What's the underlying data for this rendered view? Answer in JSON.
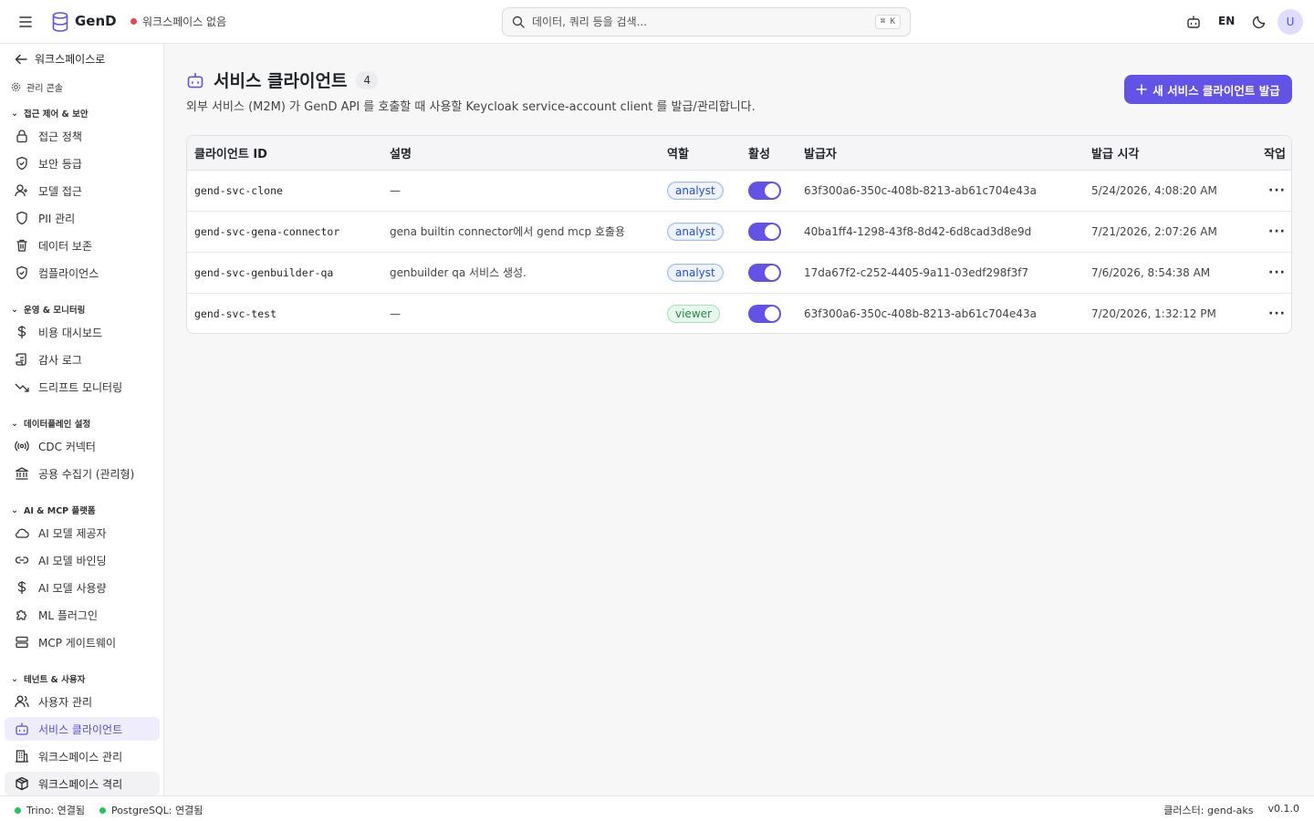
{
  "header": {
    "brand": "GenD",
    "workspace_status": "워크스페이스 없음",
    "workspace_status_color": "#e5484d",
    "search_placeholder": "데이터, 쿼리 등을 검색...",
    "search_shortcut": "⌘ K",
    "lang": "EN",
    "avatar": "U"
  },
  "sidebar": {
    "back_label": "워크스페이스로",
    "admin_label": "관리 콘솔",
    "sections": [
      {
        "label": "접근 제어 & 보안",
        "items": [
          "접근 정책",
          "보안 등급",
          "모델 접근",
          "PII 관리",
          "데이터 보존",
          "컴플라이언스"
        ]
      },
      {
        "label": "운영 & 모니터링",
        "items": [
          "비용 대시보드",
          "감사 로그",
          "드리프트 모니터링"
        ]
      },
      {
        "label": "데이터플레인 설정",
        "items": [
          "CDC 커넥터",
          "공용 수집기 (관리형)"
        ]
      },
      {
        "label": "AI & MCP 플랫폼",
        "items": [
          "AI 모델 제공자",
          "AI 모델 바인딩",
          "AI 모델 사용량",
          "ML 플러그인",
          "MCP 게이트웨이"
        ]
      },
      {
        "label": "테넌트 & 사용자",
        "items": [
          "사용자 관리",
          "서비스 클라이언트",
          "워크스페이스 관리",
          "워크스페이스 격리"
        ]
      }
    ]
  },
  "main": {
    "title": "서비스 클라이언트",
    "count": "4",
    "subtitle": "외부 서비스 (M2M) 가 GenD API 를 호출할 때 사용할 Keycloak service-account client 를 발급/관리합니다.",
    "primary_button": "새 서비스 클라이언트 발급",
    "accent_color": "#6352e6",
    "table": {
      "columns": [
        "클라이언트 ID",
        "설명",
        "역할",
        "활성",
        "발급자",
        "발급 시각",
        "작업"
      ],
      "rows": [
        {
          "id": "gend-svc-clone",
          "desc": "—",
          "role": "analyst",
          "active": true,
          "issuer": "63f300a6-350c-408b-8213-ab61c704e43a",
          "issued_at": "5/24/2026, 4:08:20 AM"
        },
        {
          "id": "gend-svc-gena-connector",
          "desc": "gena builtin connector에서 gend mcp 호출용",
          "role": "analyst",
          "active": true,
          "issuer": "40ba1ff4-1298-43f8-8d42-6d8cad3d8e9d",
          "issued_at": "7/21/2026, 2:07:26 AM"
        },
        {
          "id": "gend-svc-genbuilder-qa",
          "desc": "genbuilder qa 서비스 생성.",
          "role": "analyst",
          "active": true,
          "issuer": "17da67f2-c252-4405-9a11-03edf298f3f7",
          "issued_at": "7/6/2026, 8:54:38 AM"
        },
        {
          "id": "gend-svc-test",
          "desc": "—",
          "role": "viewer",
          "active": true,
          "issuer": "63f300a6-350c-408b-8213-ab61c704e43a",
          "issued_at": "7/20/2026, 1:32:12 PM"
        }
      ]
    }
  },
  "statusbar": {
    "trino": "Trino: 연결됨",
    "postgres": "PostgreSQL: 연결됨",
    "connected_color": "#22c55e",
    "cluster": "클러스터: gend-aks",
    "version": "v0.1.0"
  }
}
